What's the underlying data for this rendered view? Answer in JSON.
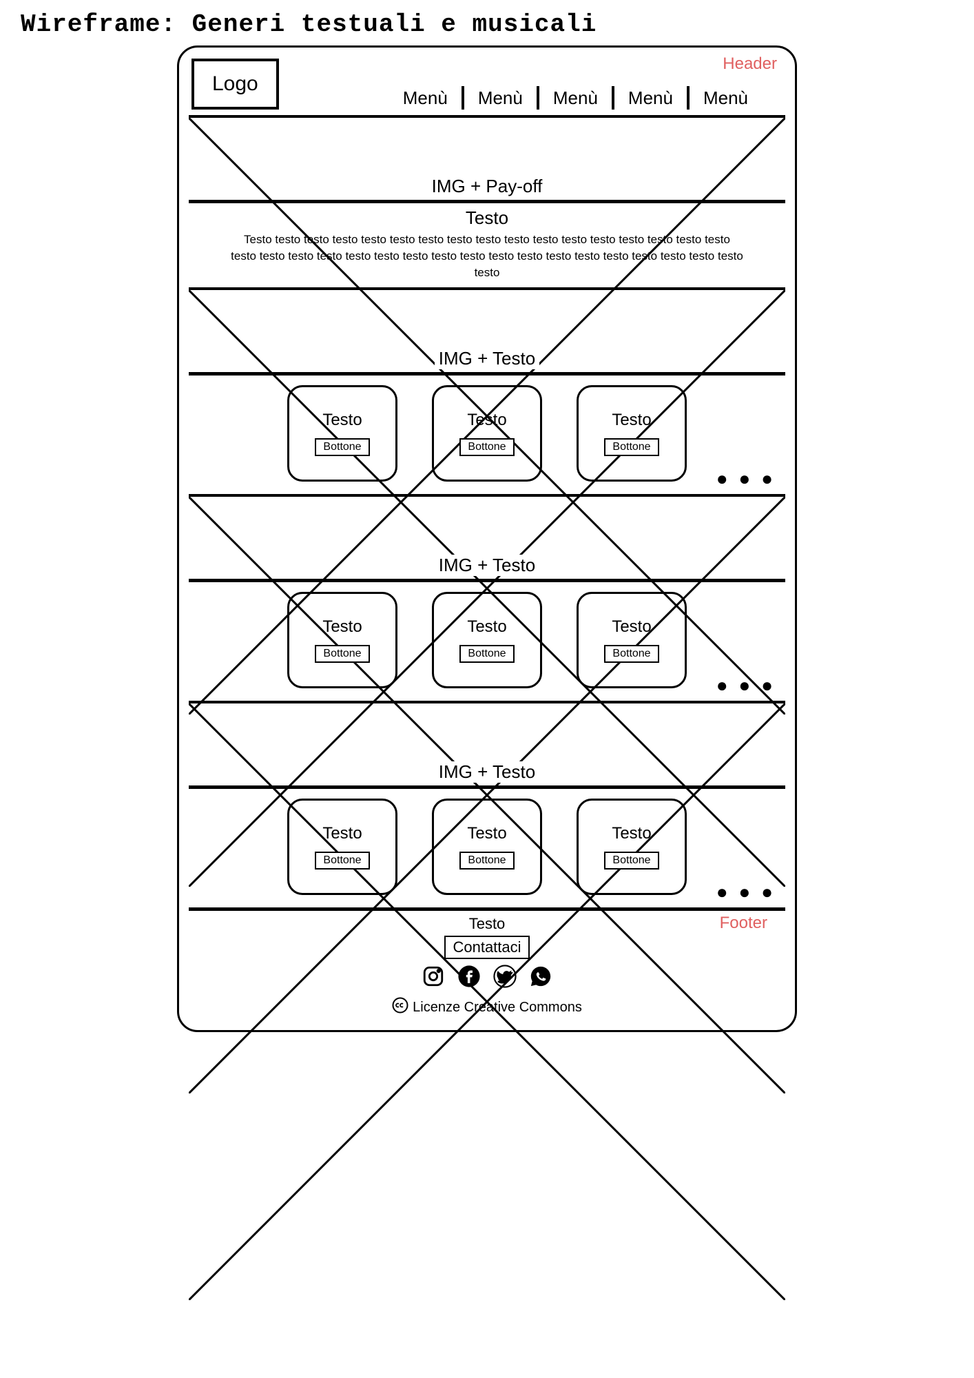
{
  "title": "Wireframe: Generi testuali e musicali",
  "labels": {
    "header": "Header",
    "footer": "Footer"
  },
  "header": {
    "logo": "Logo",
    "menu": [
      "Menù",
      "Menù",
      "Menù",
      "Menù",
      "Menù"
    ]
  },
  "hero": {
    "caption": "IMG + Pay-off"
  },
  "intro": {
    "heading": "Testo",
    "body": "Testo testo testo testo testo testo testo testo testo testo testo testo testo testo testo testo testo testo  testo testo testo testo testo testo testo testo testo testo testo testo  testo testo testo testo testo testo"
  },
  "sections": [
    {
      "img_caption": "IMG + Testo",
      "cards": [
        {
          "label": "Testo",
          "button": "Bottone"
        },
        {
          "label": "Testo",
          "button": "Bottone"
        },
        {
          "label": "Testo",
          "button": "Bottone"
        }
      ],
      "more": "● ● ●"
    },
    {
      "img_caption": "IMG + Testo",
      "cards": [
        {
          "label": "Testo",
          "button": "Bottone"
        },
        {
          "label": "Testo",
          "button": "Bottone"
        },
        {
          "label": "Testo",
          "button": "Bottone"
        }
      ],
      "more": "● ● ●"
    },
    {
      "img_caption": "IMG + Testo",
      "cards": [
        {
          "label": "Testo",
          "button": "Bottone"
        },
        {
          "label": "Testo",
          "button": "Bottone"
        },
        {
          "label": "Testo",
          "button": "Bottone"
        }
      ],
      "more": "● ● ●"
    }
  ],
  "footer": {
    "text": "Testo",
    "contact": "Contattaci",
    "cc": "Licenze Creative Commons"
  }
}
